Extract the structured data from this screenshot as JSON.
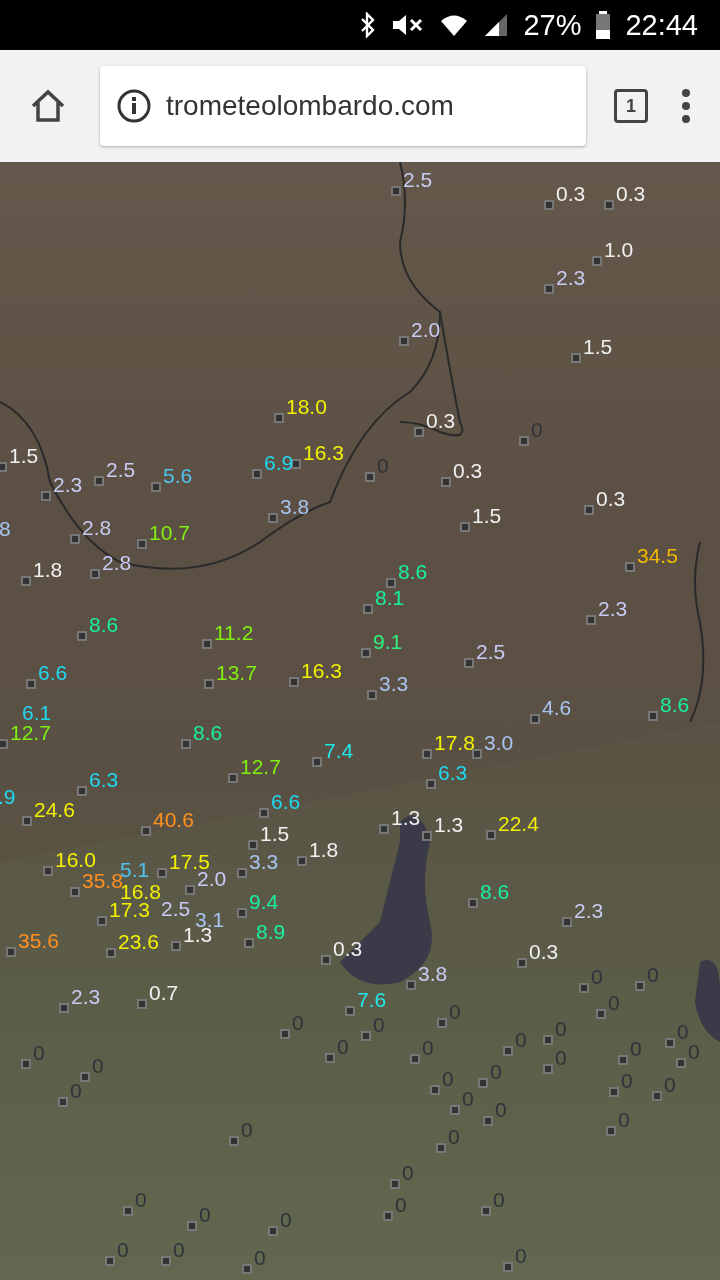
{
  "status_bar": {
    "battery": "27%",
    "time": "22:44"
  },
  "browser": {
    "url": "trometeolombardo.com",
    "tab_count": "1"
  },
  "map": {
    "labels": [
      {
        "text": "2.5",
        "color": "#c8ccf4"
      },
      {
        "text": "0.3",
        "color": "#f0f0f0"
      },
      {
        "text": "0.3",
        "color": "#f0f0f0"
      },
      {
        "text": "1.0",
        "color": "#f0f0f0"
      },
      {
        "text": "2.3",
        "color": "#c8ccf4"
      },
      {
        "text": "2.0",
        "color": "#c8ccf4"
      },
      {
        "text": "1.5",
        "color": "#f0f0f0"
      },
      {
        "text": "18.0",
        "color": "#f2f000"
      },
      {
        "text": "0.3",
        "color": "#f0f0f0"
      },
      {
        "text": "16.3",
        "color": "#f2f000"
      },
      {
        "text": "6.9",
        "color": "#20d8f0"
      },
      {
        "text": "1.5",
        "color": "#f0f0f0"
      },
      {
        "text": "2.3",
        "color": "#c8ccf4"
      },
      {
        "text": "2.5",
        "color": "#c8ccf4"
      },
      {
        "text": "5.6",
        "color": "#50c4f0"
      },
      {
        "text": "0.3",
        "color": "#f0f0f0"
      },
      {
        "text": "3.8",
        "color": "#a8c4f0"
      },
      {
        "text": "1.5",
        "color": "#f0f0f0"
      },
      {
        "text": "0.3",
        "color": "#f0f0f0"
      },
      {
        "text": "8",
        "color": "#a8c4f0"
      },
      {
        "text": "2.8",
        "color": "#c8ccf4"
      },
      {
        "text": "10.7",
        "color": "#80ee10"
      },
      {
        "text": "1.8",
        "color": "#f0f0f0"
      },
      {
        "text": "2.8",
        "color": "#c8ccf4"
      },
      {
        "text": "8.6",
        "color": "#18f0a0"
      },
      {
        "text": "34.5",
        "color": "#f4b800"
      },
      {
        "text": "8.1",
        "color": "#18f0a0"
      },
      {
        "text": "2.3",
        "color": "#c8ccf4"
      },
      {
        "text": "8.6",
        "color": "#18f0a0"
      },
      {
        "text": "11.2",
        "color": "#80ee10"
      },
      {
        "text": "9.1",
        "color": "#30f080"
      },
      {
        "text": "2.5",
        "color": "#c8ccf4"
      },
      {
        "text": "6.6",
        "color": "#20d8f0"
      },
      {
        "text": "13.7",
        "color": "#80ee10"
      },
      {
        "text": "16.3",
        "color": "#f2f000"
      },
      {
        "text": "3.3",
        "color": "#a8c4f0"
      },
      {
        "text": "4.6",
        "color": "#a8c4f0"
      },
      {
        "text": "8.6",
        "color": "#18f0a0"
      },
      {
        "text": "6.1",
        "color": "#20d8f0"
      },
      {
        "text": "12.7",
        "color": "#80ee10"
      },
      {
        "text": "8.6",
        "color": "#18f0a0"
      },
      {
        "text": "17.8",
        "color": "#f2f000"
      },
      {
        "text": "3.0",
        "color": "#a8c4f0"
      },
      {
        "text": "7.4",
        "color": "#20e8e8"
      },
      {
        "text": "12.7",
        "color": "#80ee10"
      },
      {
        "text": "6.3",
        "color": "#20d8f0"
      },
      {
        "text": "6.3",
        "color": "#20d8f0"
      },
      {
        "text": ".9",
        "color": "#20d8f0"
      },
      {
        "text": "24.6",
        "color": "#f2f000"
      },
      {
        "text": "40.6",
        "color": "#ff9020"
      },
      {
        "text": "6.6",
        "color": "#20d8f0"
      },
      {
        "text": "1.3",
        "color": "#f0f0f0"
      },
      {
        "text": "1.3",
        "color": "#f0f0f0"
      },
      {
        "text": "22.4",
        "color": "#f2f000"
      },
      {
        "text": "1.5",
        "color": "#f0f0f0"
      },
      {
        "text": "1.8",
        "color": "#f0f0f0"
      },
      {
        "text": "16.0",
        "color": "#f2f000"
      },
      {
        "text": "17.5",
        "color": "#f2f000"
      },
      {
        "text": "5.1",
        "color": "#50c4f0"
      },
      {
        "text": "3.3",
        "color": "#a8c4f0"
      },
      {
        "text": "35.8",
        "color": "#ff9020"
      },
      {
        "text": "2.0",
        "color": "#c8ccf4"
      },
      {
        "text": "16.8",
        "color": "#f2f000"
      },
      {
        "text": "17.3",
        "color": "#f2f000"
      },
      {
        "text": "2.5",
        "color": "#c8ccf4"
      },
      {
        "text": "9.4",
        "color": "#18f0a0"
      },
      {
        "text": "8.6",
        "color": "#18f0a0"
      },
      {
        "text": "2.3",
        "color": "#c8ccf4"
      },
      {
        "text": "3.1",
        "color": "#a8c4f0"
      },
      {
        "text": "1.3",
        "color": "#f0f0f0"
      },
      {
        "text": "8.9",
        "color": "#18f0a0"
      },
      {
        "text": "35.6",
        "color": "#ff9020"
      },
      {
        "text": "23.6",
        "color": "#f2f000"
      },
      {
        "text": "0.3",
        "color": "#f0f0f0"
      },
      {
        "text": "0.3",
        "color": "#f0f0f0"
      },
      {
        "text": "3.8",
        "color": "#c8ccf4"
      },
      {
        "text": "2.3",
        "color": "#c8ccf4"
      },
      {
        "text": "0.7",
        "color": "#f0f0f0"
      },
      {
        "text": "7.6",
        "color": "#20e8e8"
      },
      {
        "text": "0",
        "color": "#30343a"
      },
      {
        "text": "0",
        "color": "#30343a"
      },
      {
        "text": "0",
        "color": "#30343a"
      },
      {
        "text": "0",
        "color": "#30343a"
      },
      {
        "text": "0",
        "color": "#30343a"
      },
      {
        "text": "0",
        "color": "#30343a"
      },
      {
        "text": "0",
        "color": "#30343a"
      },
      {
        "text": "0",
        "color": "#30343a"
      },
      {
        "text": "0",
        "color": "#30343a"
      },
      {
        "text": "0",
        "color": "#30343a"
      },
      {
        "text": "0",
        "color": "#30343a"
      },
      {
        "text": "0",
        "color": "#30343a"
      },
      {
        "text": "0",
        "color": "#30343a"
      },
      {
        "text": "0",
        "color": "#30343a"
      },
      {
        "text": "0",
        "color": "#30343a"
      },
      {
        "text": "0",
        "color": "#30343a"
      },
      {
        "text": "0",
        "color": "#30343a"
      },
      {
        "text": "0",
        "color": "#30343a"
      },
      {
        "text": "0",
        "color": "#30343a"
      },
      {
        "text": "0",
        "color": "#30343a"
      },
      {
        "text": "0",
        "color": "#30343a"
      },
      {
        "text": "0",
        "color": "#30343a"
      },
      {
        "text": "0",
        "color": "#30343a"
      },
      {
        "text": "0",
        "color": "#30343a"
      },
      {
        "text": "0",
        "color": "#30343a"
      },
      {
        "text": "0",
        "color": "#30343a"
      },
      {
        "text": "0",
        "color": "#30343a"
      },
      {
        "text": "0",
        "color": "#30343a"
      },
      {
        "text": "0",
        "color": "#30343a"
      },
      {
        "text": "0",
        "color": "#30343a"
      },
      {
        "text": "0",
        "color": "#30343a"
      },
      {
        "text": "0",
        "color": "#30343a"
      },
      {
        "text": "0",
        "color": "#30343a"
      },
      {
        "text": "0",
        "color": "#30343a"
      },
      {
        "text": "0",
        "color": "#30343a"
      },
      {
        "text": "0",
        "color": "#30343a"
      },
      {
        "text": "0",
        "color": "#30343a"
      },
      {
        "text": "0",
        "color": "#30343a"
      }
    ]
  }
}
